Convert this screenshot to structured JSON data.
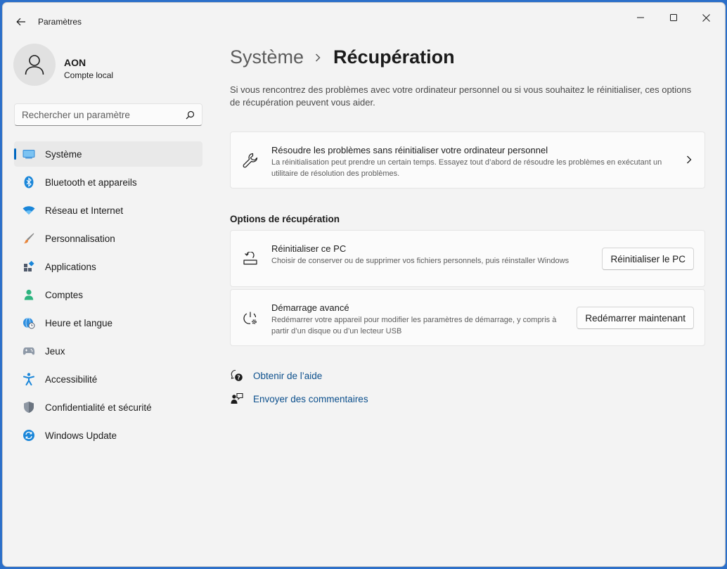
{
  "window": {
    "app_title": "Paramètres"
  },
  "profile": {
    "name": "AON",
    "subtitle": "Compte local"
  },
  "search": {
    "placeholder": "Rechercher un paramètre"
  },
  "sidebar": {
    "items": [
      {
        "label": "Système",
        "icon": "system-icon",
        "active": true
      },
      {
        "label": "Bluetooth et appareils",
        "icon": "bluetooth-icon"
      },
      {
        "label": "Réseau et Internet",
        "icon": "wifi-icon"
      },
      {
        "label": "Personnalisation",
        "icon": "brush-icon"
      },
      {
        "label": "Applications",
        "icon": "apps-icon"
      },
      {
        "label": "Comptes",
        "icon": "person-icon"
      },
      {
        "label": "Heure et langue",
        "icon": "globe-clock-icon"
      },
      {
        "label": "Jeux",
        "icon": "gamepad-icon"
      },
      {
        "label": "Accessibilité",
        "icon": "accessibility-icon"
      },
      {
        "label": "Confidentialité et sécurité",
        "icon": "shield-icon"
      },
      {
        "label": "Windows Update",
        "icon": "update-icon"
      }
    ]
  },
  "main": {
    "breadcrumb_parent": "Système",
    "breadcrumb_current": "Récupération",
    "intro": "Si vous rencontrez des problèmes avec votre ordinateur personnel ou si vous souhaitez le réinitialiser, ces options de récupération peuvent vous aider.",
    "troubleshoot": {
      "title": "Résoudre les problèmes sans réinitialiser votre ordinateur personnel",
      "desc": "La réinitialisation peut prendre un certain temps. Essayez tout d’abord de résoudre les problèmes en exécutant un utilitaire de résolution des problèmes."
    },
    "section_title": "Options de récupération",
    "reset": {
      "title": "Réinitialiser ce PC",
      "desc": "Choisir de conserver ou de supprimer vos fichiers personnels, puis réinstaller Windows",
      "button": "Réinitialiser le PC"
    },
    "advanced": {
      "title": "Démarrage avancé",
      "desc": "Redémarrer votre appareil pour modifier les paramètres de démarrage, y compris à partir d’un disque ou d’un lecteur USB",
      "button": "Redémarrer maintenant"
    },
    "links": {
      "help": "Obtenir de l’aide",
      "feedback": "Envoyer des commentaires"
    }
  },
  "colors": {
    "accent": "#0067c0",
    "link": "#0b4f8c"
  }
}
